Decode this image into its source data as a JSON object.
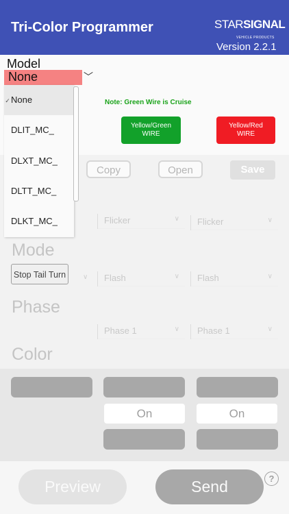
{
  "header": {
    "title": "Tri-Color Programmer",
    "logo_light": "STAR",
    "logo_bold": "SIGNAL",
    "logo_sub": "VEHICLE PRODUCTS",
    "version": "Version 2.2.1"
  },
  "model": {
    "label": "Model",
    "selected": "None",
    "options": [
      {
        "label": "None",
        "selected": true
      },
      {
        "label": "DLIT_MC_",
        "selected": false
      },
      {
        "label": "DLXT_MC_",
        "selected": false
      },
      {
        "label": "DLTT_MC_",
        "selected": false
      },
      {
        "label": "DLKT_MC_",
        "selected": false
      }
    ]
  },
  "note": "Note: Green Wire is Cruise",
  "wires": {
    "green": {
      "line1": "Yellow/Green",
      "line2": "WIRE",
      "color": "#12a12a"
    },
    "red": {
      "line1": "Yellow/Red",
      "line2": "WIRE",
      "color": "#f01c24"
    }
  },
  "actions": {
    "copy": "Copy",
    "open": "Open",
    "save": "Save"
  },
  "pattern_row": {
    "col2": "Flicker",
    "col3": "Flicker"
  },
  "mode": {
    "label": "Mode",
    "value": "Stop Tail Turn",
    "col2": "Flash",
    "col3": "Flash"
  },
  "phase": {
    "label": "Phase",
    "col2": "Phase 1",
    "col3": "Phase 1"
  },
  "color": {
    "label": "Color",
    "on2": "On",
    "on3": "On"
  },
  "bottom": {
    "preview": "Preview",
    "send": "Send",
    "help": "?"
  }
}
